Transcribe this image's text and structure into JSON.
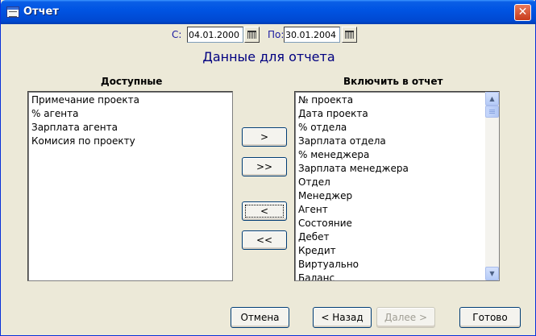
{
  "window": {
    "title": "Отчет",
    "close_glyph": "✕"
  },
  "dates": {
    "from_label": "С:",
    "from_value": "04.01.2000",
    "to_label": "По:",
    "to_value": "30.01.2004"
  },
  "heading": "Данные для отчета",
  "available": {
    "caption": "Доступные",
    "items": [
      "Примечание проекта",
      "% агента",
      "Зарплата агента",
      "Комисия по проекту"
    ]
  },
  "included": {
    "caption": "Включить в отчет",
    "items": [
      "№ проекта",
      "Дата проекта",
      "% отдела",
      "Зарплата отдела",
      "% менеджера",
      "Зарплата менеджера",
      "Отдел",
      "Менеджер",
      "Агент",
      "Состояние",
      "Дебет",
      "Кредит",
      "Виртуально",
      "Баланс"
    ]
  },
  "move_buttons": {
    "add_one": ">",
    "add_all": ">>",
    "remove_one": "<",
    "remove_all": "<<"
  },
  "footer": {
    "cancel": "Отмена",
    "back": "< Назад",
    "next": "Далее >",
    "finish": "Готово"
  },
  "icons": {
    "calendar": "calendar-icon",
    "scroll_up": "▲",
    "scroll_down": "▼"
  }
}
